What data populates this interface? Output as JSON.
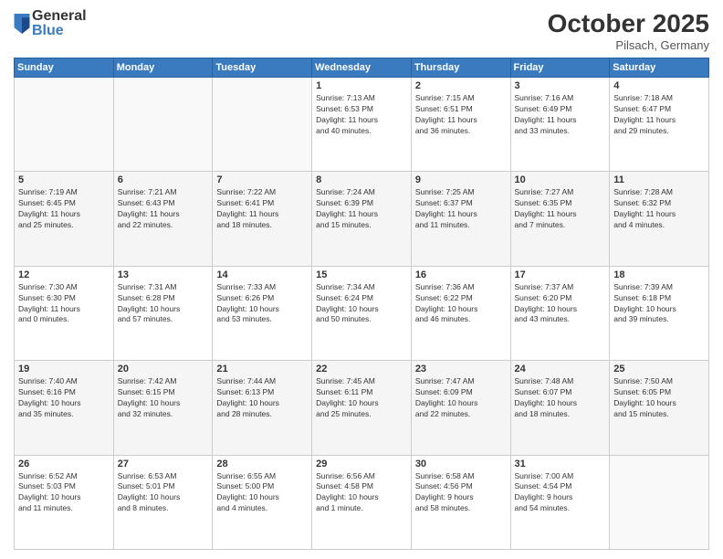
{
  "logo": {
    "general": "General",
    "blue": "Blue"
  },
  "title": "October 2025",
  "location": "Pilsach, Germany",
  "weekdays": [
    "Sunday",
    "Monday",
    "Tuesday",
    "Wednesday",
    "Thursday",
    "Friday",
    "Saturday"
  ],
  "weeks": [
    [
      {
        "day": "",
        "info": ""
      },
      {
        "day": "",
        "info": ""
      },
      {
        "day": "",
        "info": ""
      },
      {
        "day": "1",
        "info": "Sunrise: 7:13 AM\nSunset: 6:53 PM\nDaylight: 11 hours\nand 40 minutes."
      },
      {
        "day": "2",
        "info": "Sunrise: 7:15 AM\nSunset: 6:51 PM\nDaylight: 11 hours\nand 36 minutes."
      },
      {
        "day": "3",
        "info": "Sunrise: 7:16 AM\nSunset: 6:49 PM\nDaylight: 11 hours\nand 33 minutes."
      },
      {
        "day": "4",
        "info": "Sunrise: 7:18 AM\nSunset: 6:47 PM\nDaylight: 11 hours\nand 29 minutes."
      }
    ],
    [
      {
        "day": "5",
        "info": "Sunrise: 7:19 AM\nSunset: 6:45 PM\nDaylight: 11 hours\nand 25 minutes."
      },
      {
        "day": "6",
        "info": "Sunrise: 7:21 AM\nSunset: 6:43 PM\nDaylight: 11 hours\nand 22 minutes."
      },
      {
        "day": "7",
        "info": "Sunrise: 7:22 AM\nSunset: 6:41 PM\nDaylight: 11 hours\nand 18 minutes."
      },
      {
        "day": "8",
        "info": "Sunrise: 7:24 AM\nSunset: 6:39 PM\nDaylight: 11 hours\nand 15 minutes."
      },
      {
        "day": "9",
        "info": "Sunrise: 7:25 AM\nSunset: 6:37 PM\nDaylight: 11 hours\nand 11 minutes."
      },
      {
        "day": "10",
        "info": "Sunrise: 7:27 AM\nSunset: 6:35 PM\nDaylight: 11 hours\nand 7 minutes."
      },
      {
        "day": "11",
        "info": "Sunrise: 7:28 AM\nSunset: 6:32 PM\nDaylight: 11 hours\nand 4 minutes."
      }
    ],
    [
      {
        "day": "12",
        "info": "Sunrise: 7:30 AM\nSunset: 6:30 PM\nDaylight: 11 hours\nand 0 minutes."
      },
      {
        "day": "13",
        "info": "Sunrise: 7:31 AM\nSunset: 6:28 PM\nDaylight: 10 hours\nand 57 minutes."
      },
      {
        "day": "14",
        "info": "Sunrise: 7:33 AM\nSunset: 6:26 PM\nDaylight: 10 hours\nand 53 minutes."
      },
      {
        "day": "15",
        "info": "Sunrise: 7:34 AM\nSunset: 6:24 PM\nDaylight: 10 hours\nand 50 minutes."
      },
      {
        "day": "16",
        "info": "Sunrise: 7:36 AM\nSunset: 6:22 PM\nDaylight: 10 hours\nand 46 minutes."
      },
      {
        "day": "17",
        "info": "Sunrise: 7:37 AM\nSunset: 6:20 PM\nDaylight: 10 hours\nand 43 minutes."
      },
      {
        "day": "18",
        "info": "Sunrise: 7:39 AM\nSunset: 6:18 PM\nDaylight: 10 hours\nand 39 minutes."
      }
    ],
    [
      {
        "day": "19",
        "info": "Sunrise: 7:40 AM\nSunset: 6:16 PM\nDaylight: 10 hours\nand 35 minutes."
      },
      {
        "day": "20",
        "info": "Sunrise: 7:42 AM\nSunset: 6:15 PM\nDaylight: 10 hours\nand 32 minutes."
      },
      {
        "day": "21",
        "info": "Sunrise: 7:44 AM\nSunset: 6:13 PM\nDaylight: 10 hours\nand 28 minutes."
      },
      {
        "day": "22",
        "info": "Sunrise: 7:45 AM\nSunset: 6:11 PM\nDaylight: 10 hours\nand 25 minutes."
      },
      {
        "day": "23",
        "info": "Sunrise: 7:47 AM\nSunset: 6:09 PM\nDaylight: 10 hours\nand 22 minutes."
      },
      {
        "day": "24",
        "info": "Sunrise: 7:48 AM\nSunset: 6:07 PM\nDaylight: 10 hours\nand 18 minutes."
      },
      {
        "day": "25",
        "info": "Sunrise: 7:50 AM\nSunset: 6:05 PM\nDaylight: 10 hours\nand 15 minutes."
      }
    ],
    [
      {
        "day": "26",
        "info": "Sunrise: 6:52 AM\nSunset: 5:03 PM\nDaylight: 10 hours\nand 11 minutes."
      },
      {
        "day": "27",
        "info": "Sunrise: 6:53 AM\nSunset: 5:01 PM\nDaylight: 10 hours\nand 8 minutes."
      },
      {
        "day": "28",
        "info": "Sunrise: 6:55 AM\nSunset: 5:00 PM\nDaylight: 10 hours\nand 4 minutes."
      },
      {
        "day": "29",
        "info": "Sunrise: 6:56 AM\nSunset: 4:58 PM\nDaylight: 10 hours\nand 1 minute."
      },
      {
        "day": "30",
        "info": "Sunrise: 6:58 AM\nSunset: 4:56 PM\nDaylight: 9 hours\nand 58 minutes."
      },
      {
        "day": "31",
        "info": "Sunrise: 7:00 AM\nSunset: 4:54 PM\nDaylight: 9 hours\nand 54 minutes."
      },
      {
        "day": "",
        "info": ""
      }
    ]
  ]
}
